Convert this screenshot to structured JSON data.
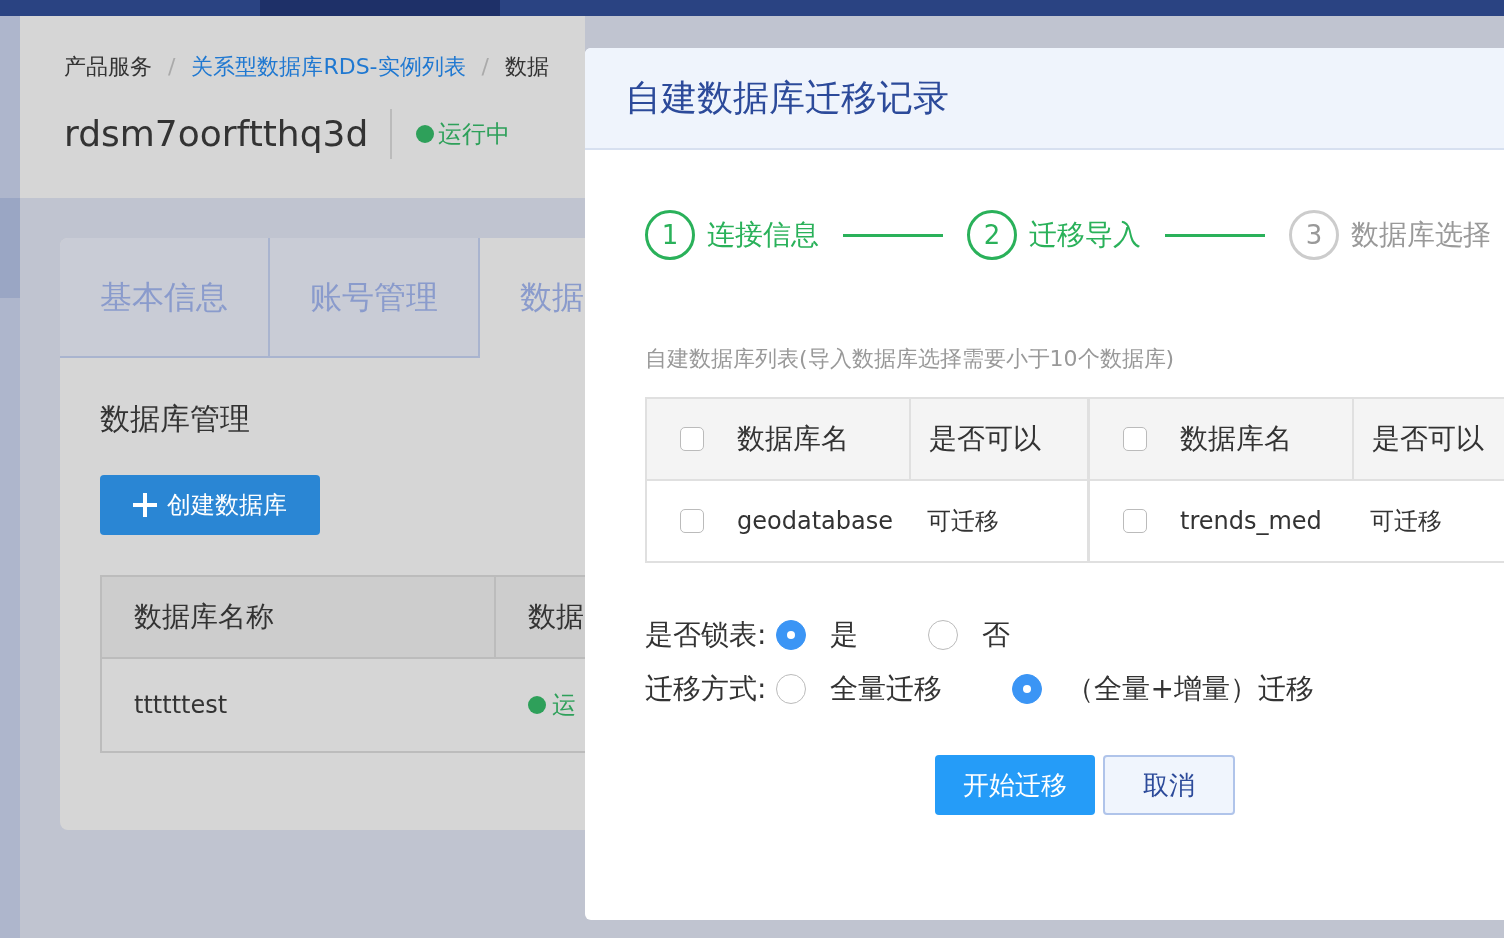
{
  "breadcrumb": [
    {
      "label": "产品服务",
      "link": false
    },
    {
      "separator": "/",
      "label": "关系型数据库RDS-实例列表",
      "link": true
    },
    {
      "separator": "/",
      "label": "数据",
      "link": false
    }
  ],
  "instance": {
    "name": "rdsm7oorftthq3d",
    "status": "运行中"
  },
  "tabs": [
    {
      "label": "基本信息",
      "selected": false
    },
    {
      "label": "账号管理",
      "selected": false
    },
    {
      "label": "数据",
      "selected": true
    }
  ],
  "section_title": "数据库管理",
  "create_button": {
    "label": "创建数据库"
  },
  "db_table": {
    "columns": [
      "数据库名称",
      "数据"
    ],
    "rows": [
      {
        "name": "ttttttest",
        "status": "运"
      }
    ]
  },
  "dialog": {
    "title": "自建数据库迁移记录",
    "steps": [
      {
        "number": "1",
        "label": "连接信息",
        "done": true
      },
      {
        "number": "2",
        "label": "迁移导入",
        "done": true
      },
      {
        "number": "3",
        "label": "数据库选择",
        "done": false
      }
    ],
    "list_caption": "自建数据库列表(导入数据库选择需要小于10个数据库)",
    "table_groups": [
      {
        "checked": false,
        "columns": [
          "数据库名",
          "是否可以"
        ],
        "rows": [
          {
            "name": "geodatabase",
            "status": "可迁移",
            "checked": false
          }
        ]
      },
      {
        "checked": false,
        "columns": [
          "数据库名",
          "是否可以"
        ],
        "rows": [
          {
            "name": "trends_med",
            "status": "可迁移",
            "checked": false
          }
        ]
      }
    ],
    "lock_table": {
      "label": "是否锁表:",
      "options": [
        {
          "label": "是",
          "selected": true
        },
        {
          "label": "否",
          "selected": false
        }
      ]
    },
    "migration_mode": {
      "label": "迁移方式:",
      "options": [
        {
          "label": "全量迁移",
          "selected": false
        },
        {
          "label": "（全量+增量）迁移",
          "selected": true
        }
      ]
    },
    "buttons": [
      {
        "label": "开始迁移",
        "kind": "primary"
      },
      {
        "label": "取消",
        "kind": "secondary"
      }
    ]
  }
}
